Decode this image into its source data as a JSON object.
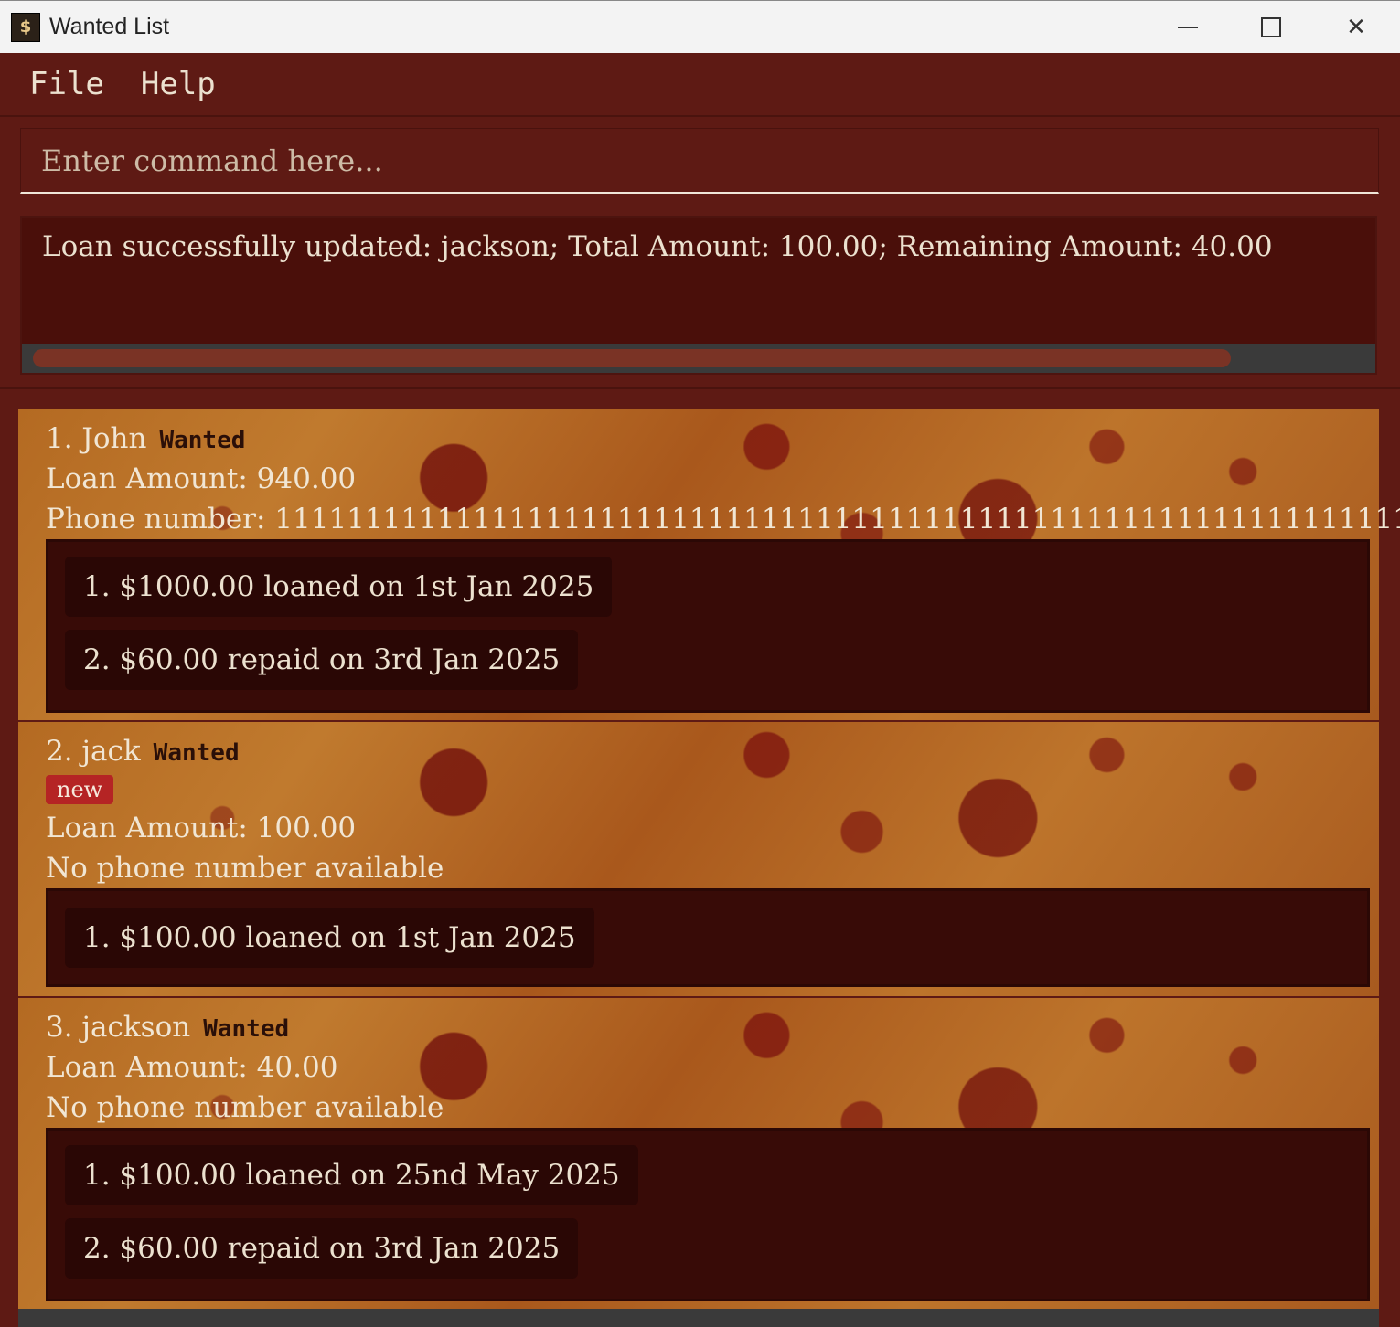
{
  "window": {
    "title": "Wanted List",
    "icon_label": "$"
  },
  "menu": {
    "file": "File",
    "help": "Help"
  },
  "command": {
    "placeholder": "Enter command here..."
  },
  "result": {
    "text": "Loan successfully updated: jackson; Total Amount: 100.00; Remaining Amount: 40.00"
  },
  "persons": [
    {
      "index_name": "1. John",
      "badge": "Wanted",
      "loan": "Loan Amount: 940.00",
      "phone": "Phone number: 1111111111111111111111111111111111111111111111111111111111111111...",
      "transactions": [
        "1. $1000.00 loaned on 1st Jan 2025",
        "2. $60.00 repaid on 3rd Jan 2025"
      ]
    },
    {
      "index_name": "2. jack",
      "badge": "Wanted",
      "tag": "new",
      "loan": "Loan Amount: 100.00",
      "phone": "No phone number available",
      "transactions": [
        "1. $100.00 loaned on 1st Jan 2025"
      ]
    },
    {
      "index_name": "3. jackson",
      "badge": "Wanted",
      "loan": "Loan Amount: 40.00",
      "phone": "No phone number available",
      "transactions": [
        "1. $100.00 loaned on 25nd May 2025",
        "2. $60.00 repaid on 3rd Jan 2025"
      ]
    }
  ]
}
